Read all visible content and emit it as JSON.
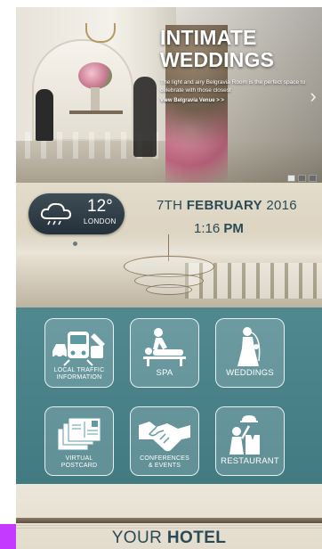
{
  "hero": {
    "title_line1": "INTIMATE",
    "title_line2": "WEDDINGS",
    "description": "The light and airy Belgravia Room is the perfect space to celebrate with those closest",
    "link": "View Belgravia Venue > >",
    "slides": 3,
    "active_slide": 0
  },
  "weather": {
    "temperature": "12°",
    "city": "LONDON",
    "icon": "rain-cloud-icon"
  },
  "datetime": {
    "date_day": "7TH ",
    "date_month": "FEBRUARY",
    "date_year": " 2016",
    "time_value": "1:16 ",
    "time_period": "PM"
  },
  "menu": {
    "tiles": [
      {
        "label_line1": "LOCAL TRAFFIC",
        "label_line2": "INFORMATION",
        "icon": "traffic-icon"
      },
      {
        "label_line1": "SPA",
        "label_line2": "",
        "icon": "spa-massage-icon"
      },
      {
        "label_line1": "WEDDINGS",
        "label_line2": "",
        "icon": "bride-icon"
      },
      {
        "label_line1": "VIRTUAL",
        "label_line2": "POSTCARD",
        "icon": "postcard-icon"
      },
      {
        "label_line1": "CONFERENCES",
        "label_line2": "& EVENTS",
        "icon": "handshake-icon"
      },
      {
        "label_line1": "RESTAURANT",
        "label_line2": "",
        "icon": "waiter-icon"
      }
    ]
  },
  "footer": {
    "brand_light": "YOUR ",
    "brand_bold": "HOTEL"
  },
  "colors": {
    "accent_teal": "#377882",
    "text_teal": "#2a4a56",
    "weather_bg": "#2f3c45"
  }
}
